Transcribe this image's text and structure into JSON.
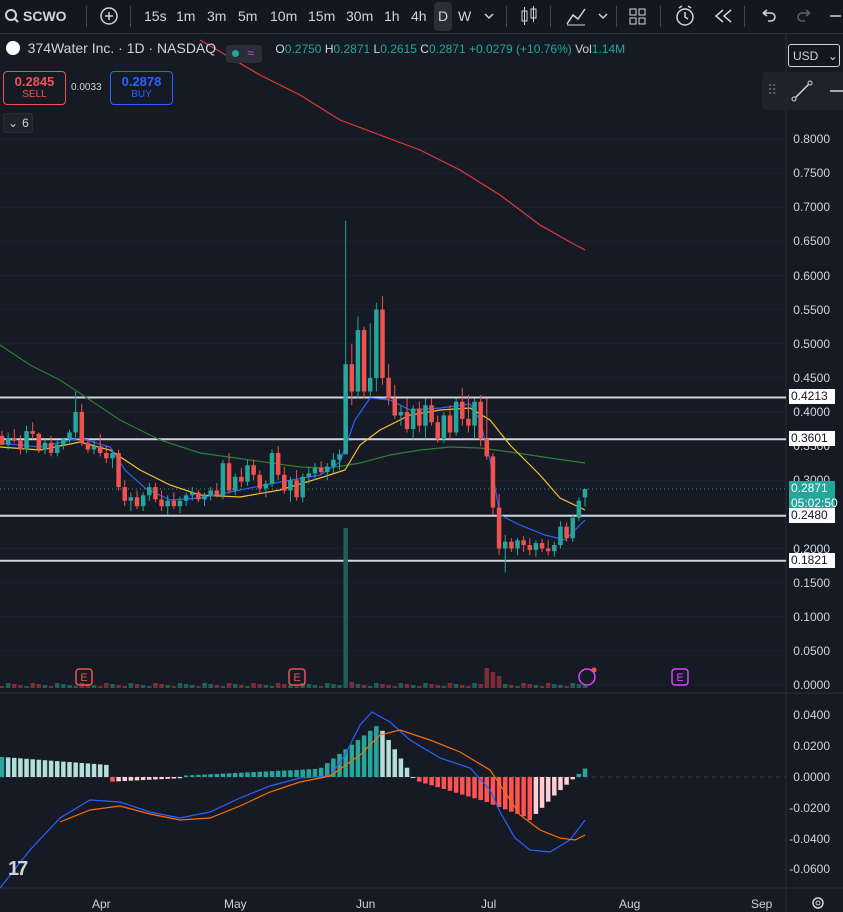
{
  "toolbar": {
    "symbol": "SCWO",
    "intervals": [
      "15s",
      "1m",
      "3m",
      "5m",
      "10m",
      "15m",
      "30m",
      "1h",
      "4h",
      "D",
      "W"
    ],
    "selected_interval": "D"
  },
  "legend": {
    "name": "374Water Inc. · 1D · NASDAQ",
    "open_label": "O",
    "open": "0.2750",
    "high_label": "H",
    "high": "0.2871",
    "low_label": "L",
    "low": "0.2615",
    "close_label": "C",
    "close": "0.2871",
    "change": "+0.0279 (+10.76%)",
    "vol_label": "Vol",
    "vol": "1.14M",
    "indicator_count": "6"
  },
  "trade": {
    "sell_price": "0.2845",
    "sell_label": "SELL",
    "spread": "0.0033",
    "buy_price": "0.2878",
    "buy_label": "BUY"
  },
  "currency": "USD",
  "price_axis": {
    "ticks": [
      "0.8000",
      "0.7500",
      "0.7000",
      "0.6500",
      "0.6000",
      "0.5500",
      "0.5000",
      "0.4500",
      "0.4000",
      "0.3500",
      "0.3000",
      "0.2500",
      "0.2000",
      "0.1500",
      "0.1000",
      "0.0500",
      "0.0000"
    ],
    "tags": [
      {
        "label": "0.4213",
        "value": 0.4213,
        "color": "#ffffff"
      },
      {
        "label": "0.3601",
        "value": 0.3601,
        "color": "#ffffff"
      },
      {
        "label": "0.2871",
        "value": 0.2871,
        "color": "#26a69a"
      },
      {
        "label": "0.2480",
        "value": 0.248,
        "color": "#ffffff"
      },
      {
        "label": "0.1821",
        "value": 0.1821,
        "color": "#ffffff"
      }
    ],
    "countdown": "05:02:50"
  },
  "macd_axis": {
    "ticks": [
      "0.0400",
      "0.0200",
      "0.0000",
      "-0.0200",
      "-0.0400",
      "-0.0600"
    ]
  },
  "time_axis": {
    "labels": [
      "Apr",
      "May",
      "Jun",
      "Jul",
      "Aug",
      "Sep"
    ]
  },
  "colors": {
    "up": "#26a69a",
    "down": "#ef5350",
    "background": "#161a25",
    "ma_fast": "#2962ff",
    "ma_mid": "#f7c12e",
    "ma_slow": "#2e7d32",
    "ma_long": "#e53935",
    "macd_line": "#2962ff",
    "signal_line": "#ff6d00"
  },
  "chart_data": {
    "type": "candlestick",
    "horizontal_levels": [
      0.4213,
      0.3601,
      0.248,
      0.1821
    ],
    "ylim": [
      0,
      0.8
    ],
    "last": {
      "open": 0.275,
      "high": 0.2871,
      "low": 0.2615,
      "close": 0.2871,
      "volume": "1.14M"
    },
    "macd_ylim": [
      -0.06,
      0.04
    ]
  }
}
